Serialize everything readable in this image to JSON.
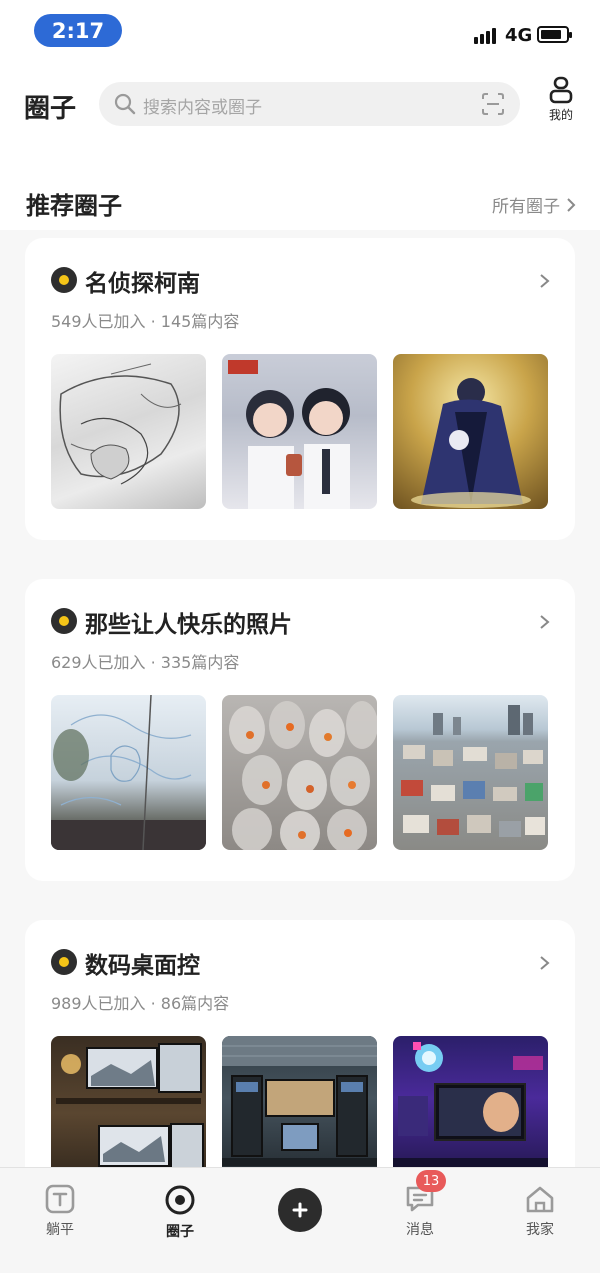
{
  "status_bar": {
    "time": "2:17",
    "network": "4G",
    "signal_bars": 4,
    "battery_level": 0.75
  },
  "header": {
    "title": "圈子",
    "search_placeholder": "搜索内容或圈子",
    "profile_label": "我的"
  },
  "section": {
    "title": "推荐圈子",
    "all_link": "所有圈子"
  },
  "circles": [
    {
      "name": "名侦探柯南",
      "meta": "549人已加入 · 145篇内容",
      "icon": "vinyl-icon",
      "images": [
        "manga-sketch-image",
        "anime-couple-image",
        "caped-character-image"
      ]
    },
    {
      "name": "那些让人快乐的照片",
      "meta": "629人已加入 · 335篇内容",
      "icon": "vinyl-icon",
      "images": [
        "window-drawing-image",
        "goldfish-bags-image",
        "city-aerial-image"
      ]
    },
    {
      "name": "数码桌面控",
      "meta": "989人已加入 · 86篇内容",
      "icon": "vinyl-icon",
      "images": [
        "desk-monitors-image",
        "desk-setup-image",
        "neon-desk-image"
      ]
    }
  ],
  "bottom_nav": {
    "items": [
      {
        "label": "躺平",
        "icon": "tangping-icon"
      },
      {
        "label": "圈子",
        "icon": "circle-icon",
        "active": true
      },
      {
        "label": "",
        "icon": "add-icon"
      },
      {
        "label": "消息",
        "icon": "message-icon",
        "badge": "13"
      },
      {
        "label": "我家",
        "icon": "home-icon"
      }
    ]
  },
  "colors": {
    "accent": "#2d6ad6",
    "badge": "#e85a5a",
    "circle_icon_center": "#f5c518"
  }
}
